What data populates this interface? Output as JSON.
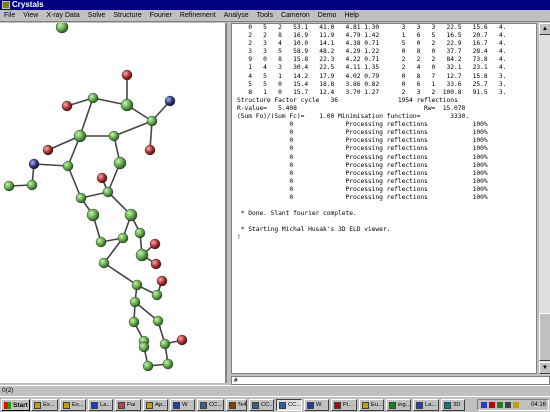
{
  "window": {
    "title": "Crystals"
  },
  "menu": [
    "File",
    "View",
    "X-ray Data",
    "Solve",
    "Structure",
    "Fourier",
    "Refinement",
    "Analyse",
    "Tools",
    "Cameron",
    "Demo",
    "Help"
  ],
  "output_lines": [
    "   0   5   2   53.1   41.0   4.81 1.30      3   3   3   22.5   15.6   4.",
    "   2   2   8   16.9   11.9   4.79 1.42      1   6   5   16.5   20.7   4.",
    "   2   3   4   10.0   14.1   4.38 0.71      5   0   2   22.9   16.7   4.",
    "   3   3   5   58.9   48.2   4.29 1.22      0   8   0   37.7   28.4   4.",
    "   9   0   8   15.8   22.3   4.22 0.71      2   2   2   84.2   73.8   4.",
    "   1   4   3   30.4   22.5   4.11 1.35      2   4   0   32.1   23.1   4.",
    "   4   5   1   14.2   17.9   4.02 0.79      0   8   7   12.7   15.8   3.",
    "   5   5   0   15.4   18.8   3.86 0.82      0   6   1   33.6   25.7   3.",
    "   8   1   0   15.7   12.4   3.70 1.27      2   3   2  100.8   91.5   3.",
    "Structure Factor cycle   36                1954 reflections",
    "R-value=   5.408                                  Rw=  15.070",
    "(Sum Fo)/(Sum Fc)=    1.00 Minimisation function=        3330.",
    "              0              Processing reflections            100%",
    "              0              Processing reflections            100%",
    "              0              Processing reflections            100%",
    "              0              Processing reflections            100%",
    "              0              Processing reflections            100%",
    "              0              Processing reflections            100%",
    "              0              Processing reflections            100%",
    "              0              Processing reflections            100%",
    "              0              Processing reflections            100%",
    "              0              Processing reflections            100%",
    "",
    " * Done. Slant fourier complete.",
    "",
    " * Starting Michal Husak's 3D ELD viewer.",
    "!"
  ],
  "command": {
    "value": "#"
  },
  "status": {
    "text": "0(2)"
  },
  "taskbar": {
    "start_label": "Start",
    "buttons": [
      {
        "label": "Ex...",
        "color": "#c0a000"
      },
      {
        "label": "Ex...",
        "color": "#c0a000"
      },
      {
        "label": "La...",
        "color": "#2040c0"
      },
      {
        "label": "Pai",
        "color": "#c04040"
      },
      {
        "label": "Ap...",
        "color": "#c0a000"
      },
      {
        "label": "W",
        "color": "#2040a0"
      },
      {
        "label": "CC...",
        "color": "#3060a0"
      },
      {
        "label": "%4",
        "color": "#804000"
      },
      {
        "label": "CC...",
        "color": "#3060a0"
      },
      {
        "label": "CC...",
        "color": "#3060a0"
      },
      {
        "label": "W",
        "color": "#2040a0"
      },
      {
        "label": "Pi...",
        "color": "#c00000"
      },
      {
        "label": "Eu...",
        "color": "#c0a000"
      },
      {
        "label": "ing...",
        "color": "#208020"
      },
      {
        "label": "La...",
        "color": "#2040c0"
      },
      {
        "label": "3D",
        "color": "#008080"
      }
    ],
    "active_index": 9,
    "clock": "04:16"
  },
  "colors": {
    "carbon": "#5fa84a",
    "oxygen": "#b03030",
    "nitrogen": "#303880",
    "bond": "#444444",
    "titlebar": "#000080"
  }
}
